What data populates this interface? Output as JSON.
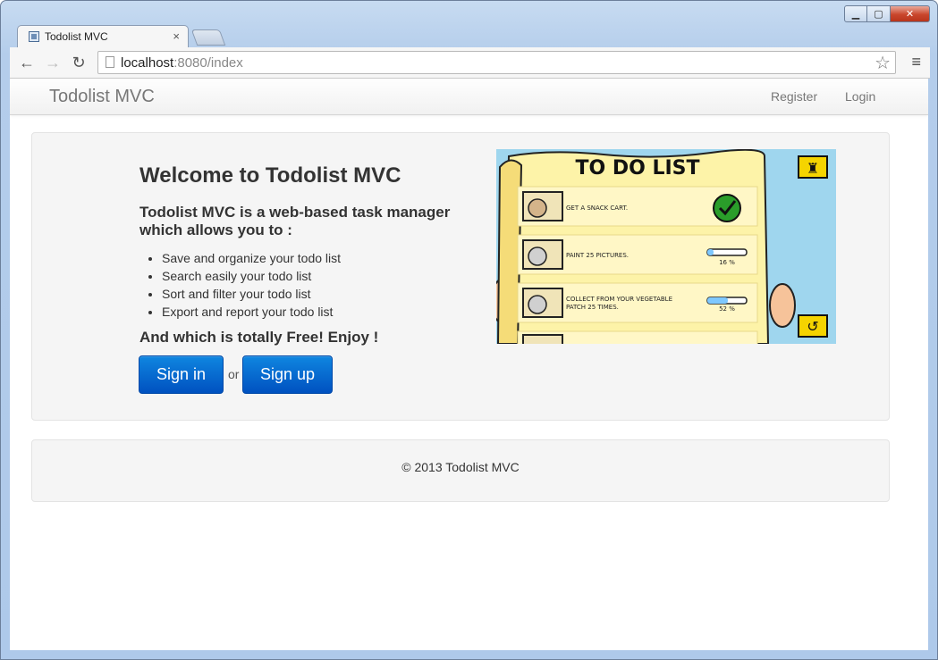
{
  "browser": {
    "tab_title": "Todolist MVC",
    "tab_close": "×",
    "url_host": "localhost",
    "url_rest": ":8080/index",
    "back_icon": "arrow-left-icon",
    "forward_icon": "arrow-right-icon",
    "reload_icon": "reload-icon",
    "star_icon": "star-icon",
    "menu_icon": "hamburger-menu-icon"
  },
  "navbar": {
    "brand": "Todolist MVC",
    "links": [
      "Register",
      "Login"
    ]
  },
  "hero": {
    "title": "Welcome to Todolist MVC",
    "subtitle": "Todolist MVC is a web-based task manager which allows you to :",
    "features": [
      "Save and organize your todo list",
      "Search easily your todo list",
      "Sort and filter your todo list",
      "Export and report your todo list"
    ],
    "tagline": "And which is totally Free! Enjoy !",
    "signin_label": "Sign in",
    "or_text": "or",
    "signup_label": "Sign up"
  },
  "illustration": {
    "heading": "TO DO LIST",
    "items": [
      {
        "text": "GET A SNACK CART.",
        "done": true
      },
      {
        "text": "PAINT 25 PICTURES.",
        "progress": "16 %"
      },
      {
        "text": "COLLECT FROM YOUR VEGETABLE PATCH 25 TIMES.",
        "progress": "52 %"
      }
    ]
  },
  "footer": {
    "copyright": "© 2013 Todolist MVC"
  },
  "colors": {
    "button_primary": "#0a6fd6",
    "hero_bg": "#f5f5f5",
    "paper": "#fdf3a8"
  }
}
